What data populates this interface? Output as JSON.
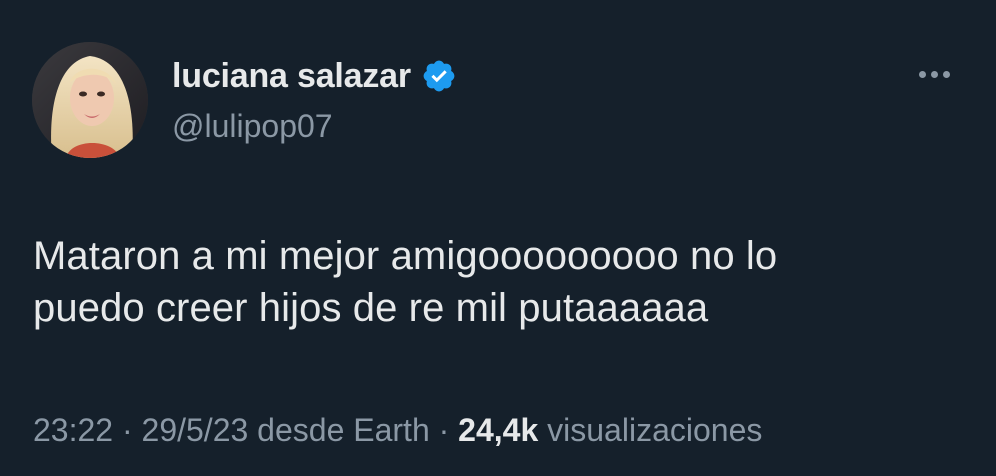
{
  "user": {
    "display_name": "luciana salazar",
    "handle": "@lulipop07",
    "verified": true
  },
  "tweet": {
    "text_lines": [
      "Mataron a mi mejor amigooooooooo no lo",
      "puedo creer hijos de re mil putaaaaaa"
    ],
    "time": "23:22",
    "date": "29/5/23",
    "source": "desde Earth",
    "views_count": "24,4k",
    "views_label": "visualizaciones"
  },
  "icons": {
    "verified": "verified-badge-icon",
    "more": "more-options-icon"
  },
  "colors": {
    "background": "#15202b",
    "primary_text": "#e7e9ea",
    "secondary_text": "#8b98a5",
    "verified_blue": "#1d9bf0"
  }
}
